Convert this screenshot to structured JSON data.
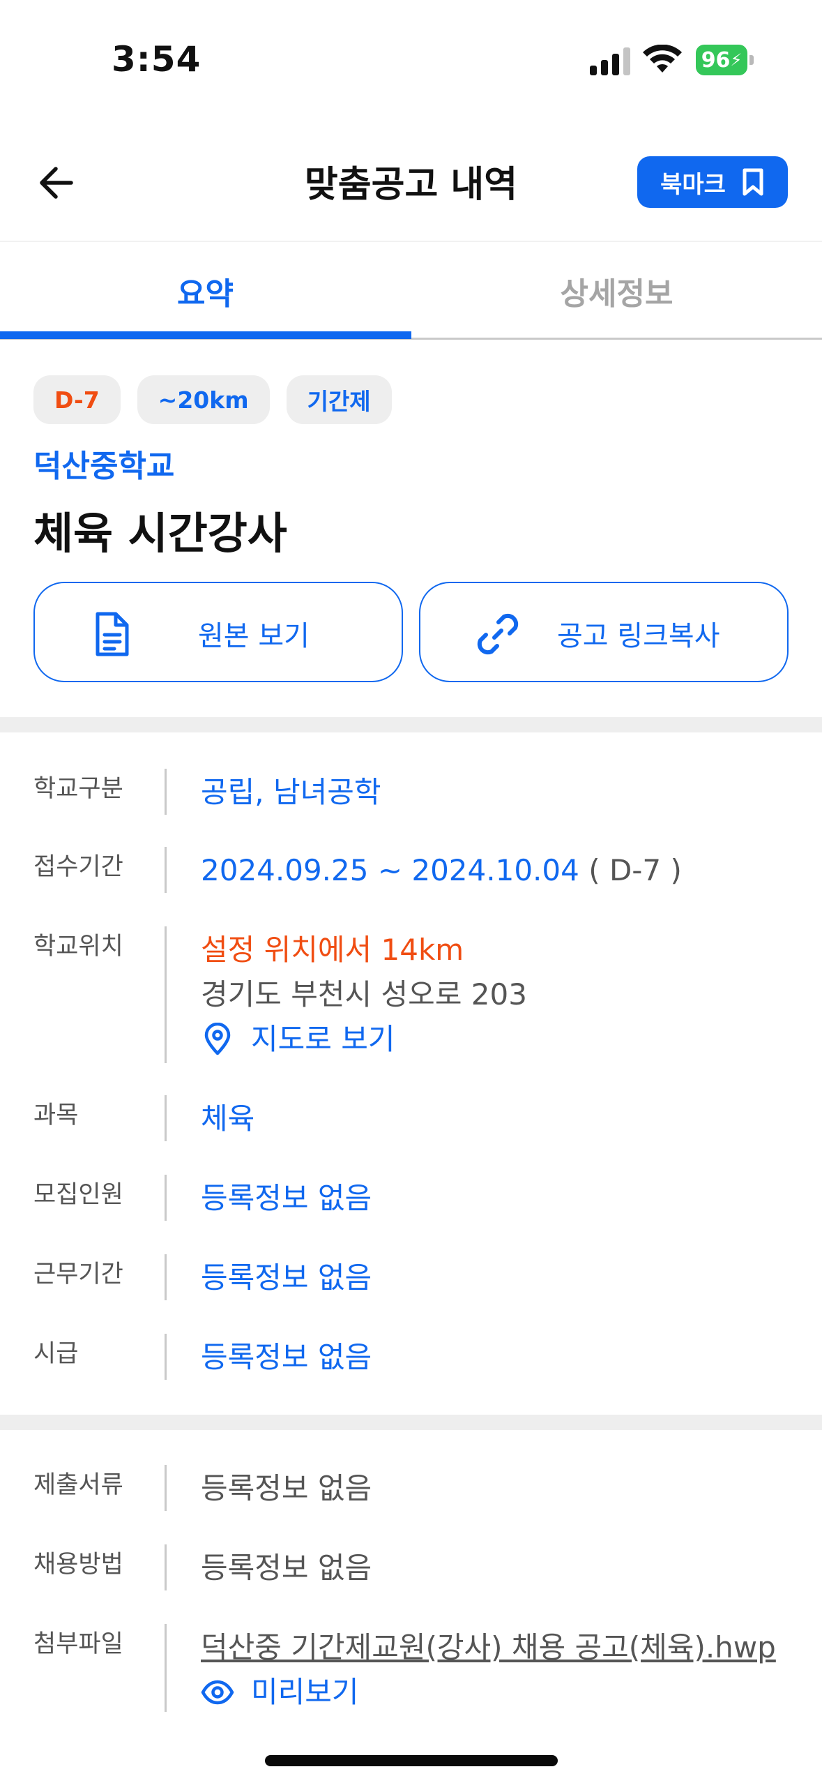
{
  "status_bar": {
    "time": "3:54",
    "battery": "96"
  },
  "header": {
    "title": "맞춤공고 내역",
    "bookmark_label": "북마크"
  },
  "tabs": [
    {
      "label": "요약"
    },
    {
      "label": "상세정보"
    }
  ],
  "chips": [
    "D-7",
    "~20km",
    "기간제"
  ],
  "school_name": "덕산중학교",
  "job_title": "체육 시간강사",
  "actions": {
    "view_original": "원본 보기",
    "copy_link": "공고 링크복사"
  },
  "info": {
    "school_type": {
      "label": "학교구분",
      "value": "공립, 남녀공학"
    },
    "period": {
      "label": "접수기간",
      "value": "2024.09.25 ~ 2024.10.04",
      "dday": "( D-7 )"
    },
    "location": {
      "label": "학교위치",
      "distance": "설정 위치에서 14km",
      "address": "경기도 부천시 성오로 203",
      "map_link": "지도로 보기"
    },
    "subject": {
      "label": "과목",
      "value": "체육"
    },
    "recruits": {
      "label": "모집인원",
      "value": "등록정보 없음"
    },
    "work_period": {
      "label": "근무기간",
      "value": "등록정보 없음"
    },
    "pay": {
      "label": "시급",
      "value": "등록정보 없음"
    }
  },
  "extra": {
    "documents": {
      "label": "제출서류",
      "value": "등록정보 없음"
    },
    "method": {
      "label": "채용방법",
      "value": "등록정보 없음"
    },
    "attachment": {
      "label": "첨부파일",
      "file": "덕산중 기간제교원(강사) 채용 공고(체육).hwp",
      "preview": "미리보기"
    }
  },
  "colors": {
    "accent": "#1068ef",
    "warning": "#f04d12",
    "battery": "#34c759"
  }
}
